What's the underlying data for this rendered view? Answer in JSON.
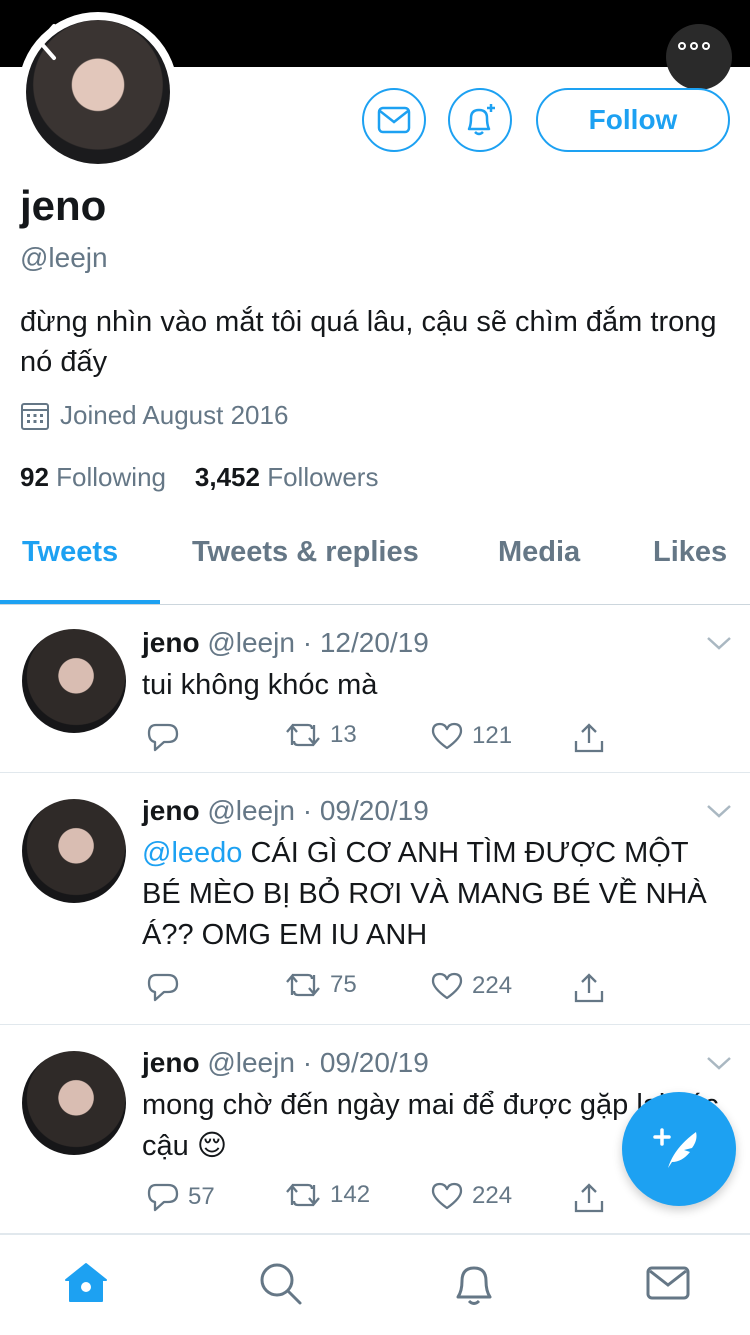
{
  "colors": {
    "accent": "#1da1f2",
    "muted": "#657786",
    "text": "#14171a"
  },
  "profile": {
    "name": "jeno",
    "handle": "@leejn",
    "bio": "đừng nhìn vào mắt tôi quá lâu, cậu sẽ chìm đắm trong nó đấy",
    "joined": "Joined August 2016",
    "following_count": "92",
    "following_label": "Following",
    "followers_count": "3,452",
    "followers_label": "Followers",
    "follow_label": "Follow"
  },
  "tabs": [
    "Tweets",
    "Tweets & replies",
    "Media",
    "Likes"
  ],
  "tweets": [
    {
      "name": "jeno",
      "handle": "@leejn",
      "date": "· 12/20/19",
      "mention": "",
      "text": "tui không khóc mà",
      "replies": "",
      "retweets": "13",
      "likes": "121"
    },
    {
      "name": "jeno",
      "handle": "@leejn",
      "date": "· 09/20/19",
      "mention": "@leedo",
      "text": " CÁI GÌ CƠ ANH TÌM ĐƯỢC MỘT BÉ MÈO BỊ BỎ RƠI VÀ MANG BÉ VỀ NHÀ Á?? OMG EM IU ANH",
      "replies": "",
      "retweets": "75",
      "likes": "224"
    },
    {
      "name": "jeno",
      "handle": "@leejn",
      "date": "· 09/20/19",
      "mention": "",
      "text": "mong chờ đến ngày mai để được gặp lại các cậu 😌",
      "replies": "57",
      "retweets": "142",
      "likes": "224"
    }
  ],
  "icons": {
    "back": "back-chevron-icon",
    "more": "more-dots-icon",
    "message": "envelope-icon",
    "notify": "bell-plus-icon",
    "joined": "calendar-icon",
    "reply": "reply-icon",
    "retweet": "retweet-icon",
    "like": "heart-icon",
    "share": "share-icon",
    "compose": "compose-feather-icon",
    "home": "home-icon",
    "search": "search-icon",
    "notifications": "bell-icon",
    "messages": "mail-icon"
  }
}
